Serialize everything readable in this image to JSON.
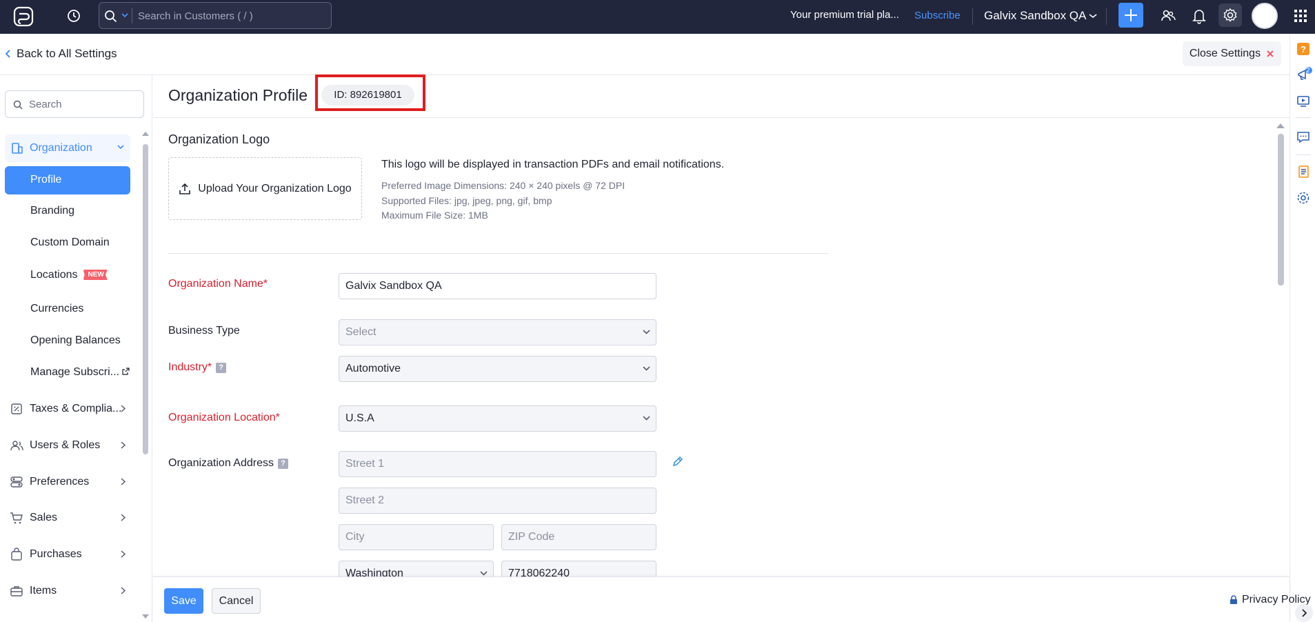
{
  "topbar": {
    "search_placeholder": "Search in Customers ( / )",
    "trial_text": "Your premium trial pla...",
    "subscribe_label": "Subscribe",
    "org_name": "Galvix Sandbox QA"
  },
  "settings": {
    "back_label": "Back to All Settings",
    "close_label": "Close Settings"
  },
  "sidebar": {
    "search_placeholder": "Search",
    "group_label": "Organization",
    "active_item": "Profile",
    "sub_items": [
      "Branding",
      "Custom Domain",
      "Locations",
      "Currencies",
      "Opening Balances",
      "Manage Subscri..."
    ],
    "new_badge": "NEW",
    "main_items": [
      "Taxes & Complia...",
      "Users & Roles",
      "Preferences",
      "Sales",
      "Purchases",
      "Items"
    ]
  },
  "rail": {
    "notification_count": "2"
  },
  "page": {
    "title": "Organization Profile",
    "org_id": "ID: 892619801"
  },
  "logo_section": {
    "label": "Organization Logo",
    "upload_label": "Upload Your Organization Logo",
    "info_main": "This logo will be displayed in transaction PDFs and email notifications.",
    "info_dims": "Preferred Image Dimensions: 240 × 240 pixels @ 72 DPI",
    "info_files": "Supported Files: jpg, jpeg, png, gif, bmp",
    "info_size": "Maximum File Size: 1MB"
  },
  "form": {
    "org_name_label": "Organization Name*",
    "org_name_value": "Galvix Sandbox QA",
    "business_type_label": "Business Type",
    "business_type_value": "Select",
    "industry_label": "Industry*",
    "industry_value": "Automotive",
    "location_label": "Organization Location*",
    "location_value": "U.S.A",
    "address_label": "Organization Address",
    "street1_placeholder": "Street 1",
    "street2_placeholder": "Street 2",
    "city_placeholder": "City",
    "zip_placeholder": "ZIP Code",
    "state_value": "Washington",
    "phone_value": "7718062240"
  },
  "footer": {
    "save_label": "Save",
    "cancel_label": "Cancel",
    "privacy_label": "Privacy Policy"
  },
  "colors": {
    "accent": "#408dfb",
    "required": "#d6202f",
    "topbar": "#21263c",
    "highlight": "#e01e1e"
  }
}
